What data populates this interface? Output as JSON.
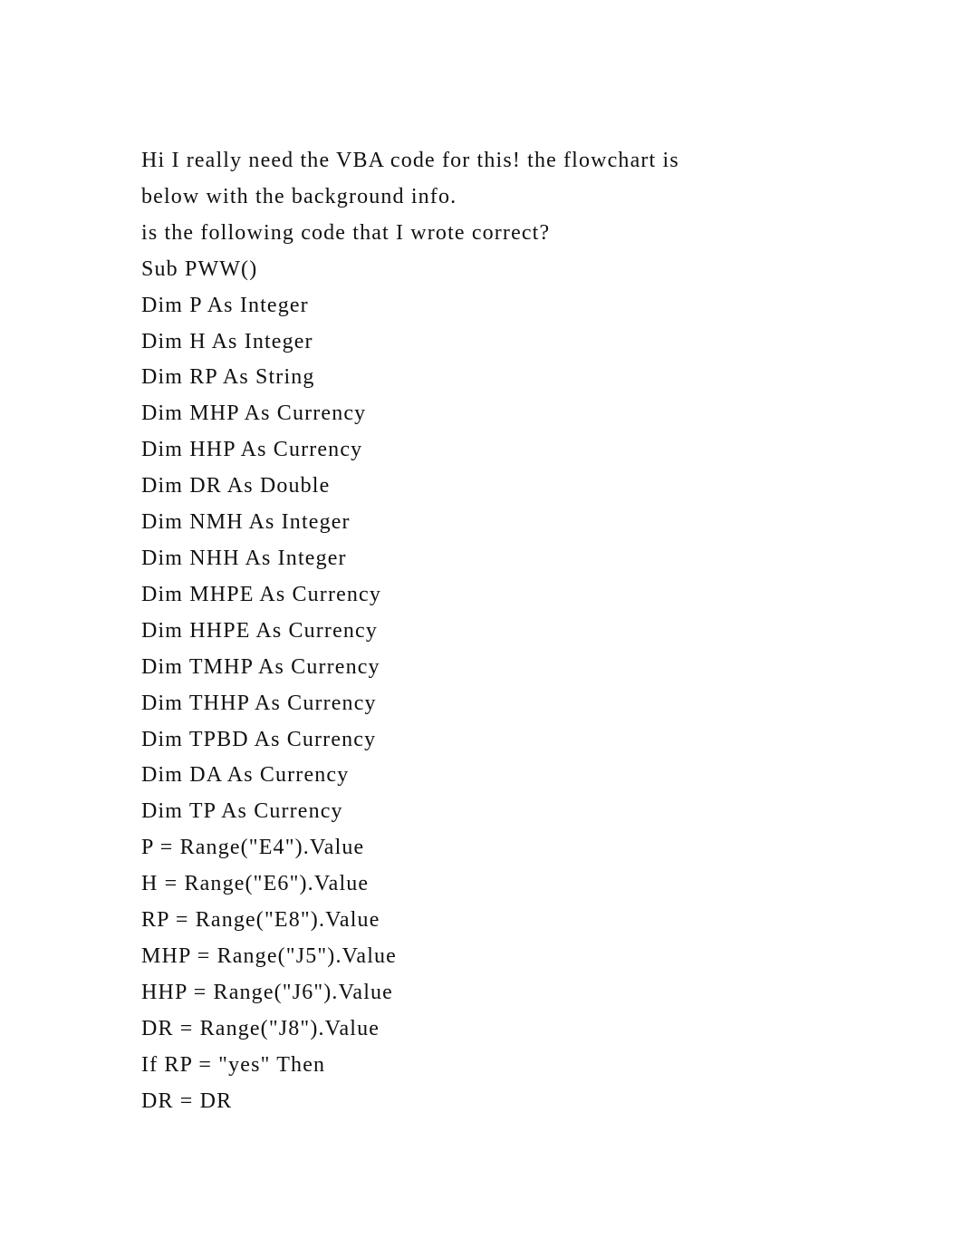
{
  "document": {
    "intro": [
      "Hi I really need the VBA code for this! the flowchart is",
      "below with the background info.",
      "is the following code that I wrote correct?"
    ],
    "code": [
      "Sub PWW()",
      "Dim P As Integer",
      "Dim H As Integer",
      "Dim RP As String",
      "Dim MHP As Currency",
      "Dim HHP As Currency",
      "Dim DR As Double",
      "Dim NMH As Integer",
      "Dim NHH As Integer",
      "Dim MHPE As Currency",
      "Dim HHPE As Currency",
      "Dim TMHP As Currency",
      "Dim THHP As Currency",
      "Dim TPBD As Currency",
      "Dim DA As Currency",
      "Dim TP As Currency",
      "P = Range(\"E4\").Value",
      "H = Range(\"E6\").Value",
      "RP = Range(\"E8\").Value",
      "MHP = Range(\"J5\").Value",
      "HHP = Range(\"J6\").Value",
      "DR = Range(\"J8\").Value",
      "If RP = \"yes\" Then",
      "DR = DR"
    ]
  }
}
